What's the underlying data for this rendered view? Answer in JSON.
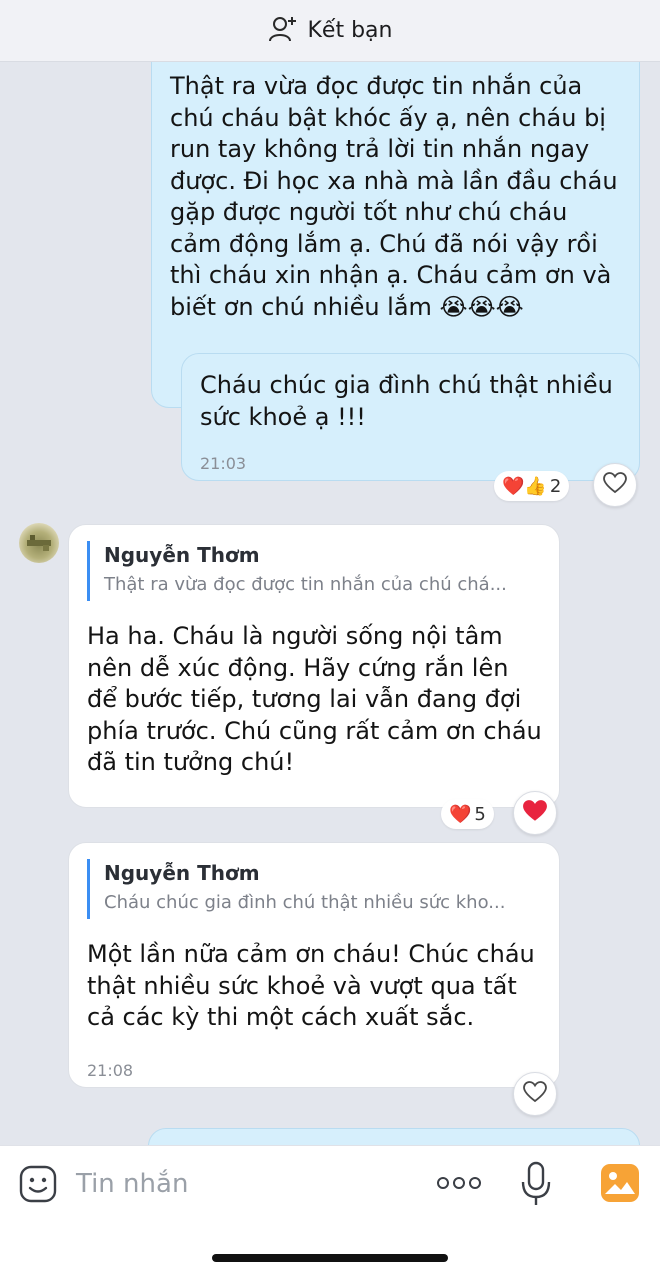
{
  "header": {
    "add_friend_label": "Kết bạn",
    "icon": "add-person-icon"
  },
  "messages": [
    {
      "sender": "me",
      "lines": [
        "Thật ra vừa đọc được tin nhắn của",
        "chú cháu bật khóc ấy ạ, nên cháu bị",
        "run tay không trả lời tin nhắn ngay",
        "được. Đi học xa nhà mà lần đầu cháu",
        "gặp được người tốt như chú cháu",
        "cảm động lắm ạ. Chú đã nói vậy rồi",
        "thì cháu xin nhận ạ. Cháu cảm ơn và",
        "biết ơn chú nhiều lắm 😭😭😭"
      ]
    },
    {
      "sender": "me",
      "lines": [
        "Cháu chúc gia đình chú thật nhiều",
        "sức khoẻ ạ !!!"
      ],
      "time": "21:03",
      "reactions": {
        "emoji": "❤️👍",
        "count": "2"
      },
      "react_button_icon": "heart-outline-icon"
    },
    {
      "sender": "Nguyễn Thơm",
      "avatar": "avatar-image",
      "quote": {
        "name": "Nguyễn Thơm",
        "text": "Thật ra vừa đọc được tin nhắn của chú chá..."
      },
      "lines": [
        "Ha ha. Cháu là người sống nội tâm",
        "nên dễ xúc động. Hãy cứng rắn lên",
        "để bước tiếp, tương lai vẫn đang đợi",
        "phía trước. Chú cũng rất cảm ơn cháu",
        "đã tin tưởng chú!"
      ],
      "reactions": {
        "emoji": "❤️",
        "count": "5"
      },
      "react_button_icon": "heart-filled-icon"
    },
    {
      "sender": "Nguyễn Thơm",
      "quote": {
        "name": "Nguyễn Thơm",
        "text": "Cháu chúc gia đình chú thật nhiều sức kho..."
      },
      "lines": [
        "Một lần nữa cảm ơn cháu! Chúc cháu",
        "thật nhiều sức khoẻ và vượt qua tất",
        "cả các kỳ thi một cách xuất sắc."
      ],
      "time": "21:08",
      "react_button_icon": "heart-outline-icon"
    }
  ],
  "composer": {
    "placeholder": "Tin nhắn",
    "icons": [
      "sticker-icon",
      "more-icon",
      "microphone-icon",
      "image-icon"
    ]
  },
  "colors": {
    "chat_background": "#e3e6ed",
    "my_bubble": "#d6effc",
    "their_bubble": "#ffffff",
    "quote_accent": "#3b8ef3",
    "image_button": "#f7a336"
  }
}
